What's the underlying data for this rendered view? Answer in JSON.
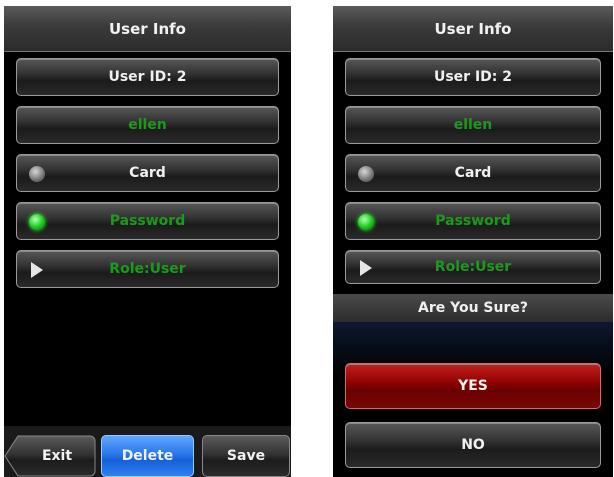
{
  "left_screen": {
    "header_title": "User Info",
    "user_id": "User ID: 2",
    "name": "ellen",
    "card_label": "Card",
    "password_label": "Password",
    "role_label": "Role:User",
    "toolbar": {
      "exit_label": "Exit",
      "delete_label": "Delete",
      "save_label": "Save"
    }
  },
  "right_screen": {
    "header_title": "User Info",
    "user_id": "User ID: 2",
    "name": "ellen",
    "card_label": "Card",
    "password_label": "Password",
    "role_label": "Role:User",
    "dialog": {
      "title": "Are You Sure?",
      "yes_label": "YES",
      "no_label": "NO"
    }
  },
  "colors": {
    "green_text": "#1c9a1c",
    "delete_blue": "#2a78ea",
    "yes_red": "#8a0000"
  },
  "icons": {
    "card_indicator": "gray-led-icon",
    "password_indicator": "green-led-icon",
    "role_indicator": "play-triangle-icon"
  }
}
